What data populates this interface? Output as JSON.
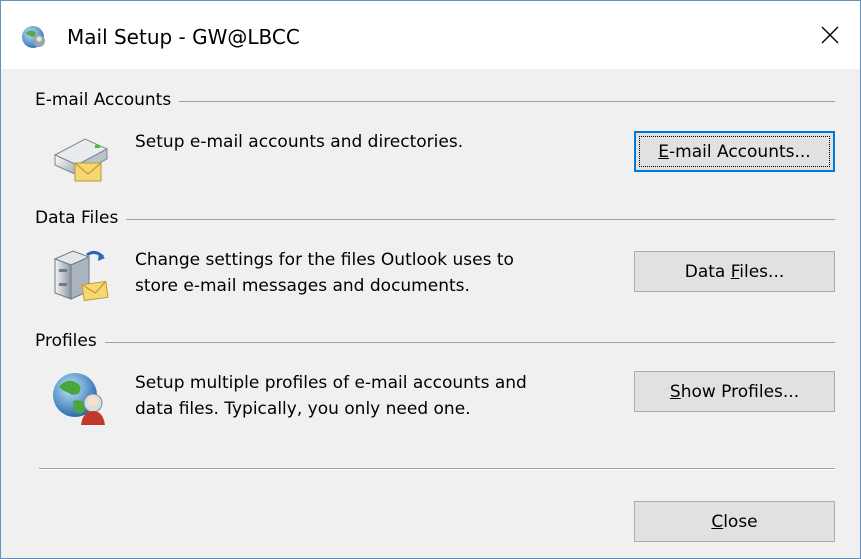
{
  "window": {
    "title": "Mail Setup - GW@LBCC"
  },
  "sections": [
    {
      "heading": "E-mail Accounts",
      "description": "Setup e-mail accounts and directories.",
      "button": {
        "pre": "",
        "mnemonic": "E",
        "post": "-mail Accounts..."
      },
      "icon": "mail-accounts-icon"
    },
    {
      "heading": "Data Files",
      "description_line1": "Change settings for the files Outlook uses to",
      "description_line2": "store e-mail messages and documents.",
      "button": {
        "pre": "Data ",
        "mnemonic": "F",
        "post": "iles..."
      },
      "icon": "data-files-icon"
    },
    {
      "heading": "Profiles",
      "description_line1": "Setup multiple profiles of e-mail accounts and",
      "description_line2": "data files. Typically, you only need one.",
      "button": {
        "pre": "",
        "mnemonic": "S",
        "post": "how Profiles..."
      },
      "icon": "profiles-icon"
    }
  ],
  "footer": {
    "close_button": {
      "pre": "",
      "mnemonic": "C",
      "post": "lose"
    }
  },
  "colors": {
    "dialog_bg": "#f0f0f0",
    "titlebar_bg": "#ffffff",
    "button_bg": "#e1e1e1",
    "button_border": "#adadad",
    "focus_border": "#0078d7",
    "window_border": "#6b8fb3"
  }
}
